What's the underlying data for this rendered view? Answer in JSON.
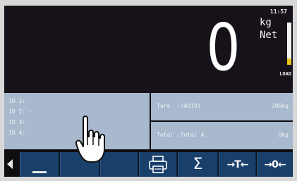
{
  "display": {
    "time": "11:57",
    "weight": "0",
    "unit": "kg",
    "mode": "Net",
    "load_label": "LOAD",
    "load_fraction": 0.15
  },
  "ids": [
    {
      "label": "ID 1:",
      "value": "-"
    },
    {
      "label": "ID 2:",
      "value": "-"
    },
    {
      "label": "ID 3:",
      "value": "-"
    },
    {
      "label": "ID 4:",
      "value": "-"
    }
  ],
  "tare": {
    "label": "Tare  :(AUTO)",
    "value": "206kg"
  },
  "total": {
    "label": "Total :Total A",
    "value": "0kg"
  },
  "softkeys": {
    "sum": "Σ",
    "tare": "→T←",
    "zero": "→0←"
  },
  "icons": [
    "left-arrow-icon",
    "dropdown-icon",
    "printer-icon",
    "sum-icon",
    "hand-pointer-icon"
  ],
  "colors": {
    "panel": "#a8b8cd",
    "key": "#193f6b",
    "load": "#e7c31b"
  }
}
